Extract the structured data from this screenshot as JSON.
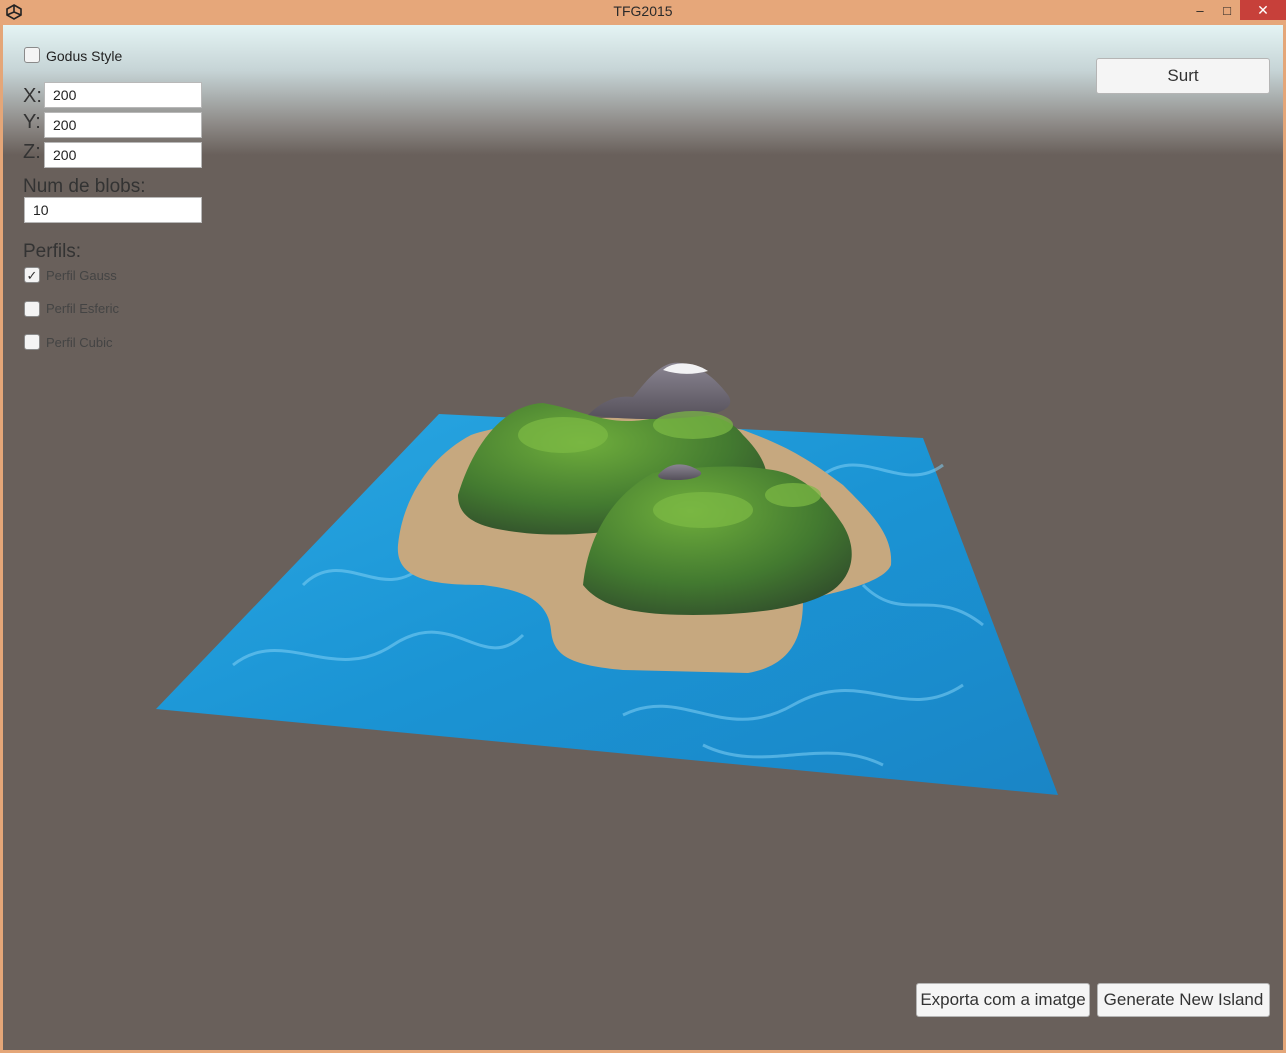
{
  "window": {
    "title": "TFG2015",
    "minimize_glyph": "–",
    "maximize_glyph": "□",
    "close_glyph": "✕",
    "app_icon": "unity-icon"
  },
  "panel": {
    "godus_style": {
      "label": "Godus Style",
      "checked": false
    },
    "dimensions": [
      {
        "label": "X:",
        "value": "200"
      },
      {
        "label": "Y:",
        "value": "200"
      },
      {
        "label": "Z:",
        "value": "200"
      }
    ],
    "blobs": {
      "label": "Num de blobs:",
      "value": "10"
    },
    "profiles": {
      "heading": "Perfils:",
      "items": [
        {
          "label": "Perfil Gauss",
          "checked": true
        },
        {
          "label": "Perfil Esferic",
          "checked": false
        },
        {
          "label": "Perfil Cubic",
          "checked": false
        }
      ]
    }
  },
  "buttons": {
    "exit": "Surt",
    "export": "Exporta com a imatge",
    "generate": "Generate New Island"
  },
  "colors": {
    "title_bar": "#e6a77a",
    "close_button": "#c7403a",
    "ground": "#69605b",
    "water": "#1c9ad8",
    "sand": "#c4a57d",
    "grass": "#4f8a2e",
    "rock": "#6f6a72"
  }
}
